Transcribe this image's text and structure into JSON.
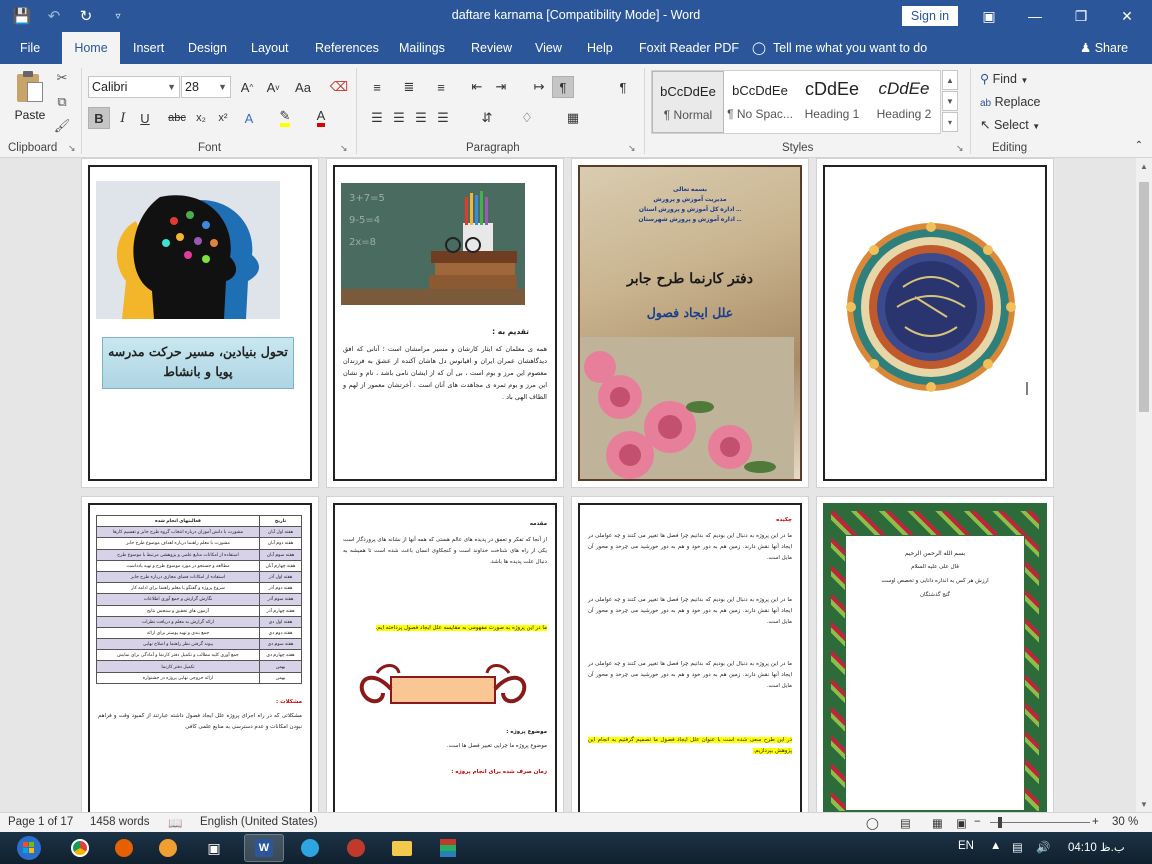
{
  "window": {
    "title": "daftare karnama [Compatibility Mode]  -  Word",
    "sign_in": "Sign in"
  },
  "tabs": {
    "items": [
      "File",
      "Home",
      "Insert",
      "Design",
      "Layout",
      "References",
      "Mailings",
      "Review",
      "View",
      "Help",
      "Foxit Reader PDF"
    ],
    "active": "Home",
    "tell_me": "Tell me what you want to do",
    "share": "Share"
  },
  "ribbon": {
    "clipboard": {
      "label": "Clipboard",
      "paste": "Paste"
    },
    "font": {
      "label": "Font",
      "family": "Calibri",
      "size": "28",
      "bold": "B",
      "italic": "I",
      "underline": "U",
      "strike": "abc"
    },
    "paragraph": {
      "label": "Paragraph"
    },
    "styles": {
      "label": "Styles",
      "items": [
        {
          "sample": "bCcDdEe",
          "name": "¶ Normal"
        },
        {
          "sample": "bCcDdEe",
          "name": "¶ No Spac..."
        },
        {
          "sample": "cDdEe",
          "name": "Heading 1"
        },
        {
          "sample": "cDdEe",
          "name": "Heading 2"
        }
      ]
    },
    "editing": {
      "label": "Editing",
      "find": "Find",
      "replace": "Replace",
      "select": "Select"
    }
  },
  "pages": {
    "p1": {
      "caption": "تحول بنیادین، مسیر حرکت مدرسه پویا و بانشاط"
    },
    "p2": {
      "dedication_title": "تقدیم به :",
      "dedication_text": "همه ی معلمان که ایثار کارشان و مسیر مرامشان است ؛ آنانی که افق دیدگاهشان عمران ایران و اقیانوس دل هاشان آکنده از عشق به فرزندان معصوم این مرز و بوم است ، بی آن که از ایشان نامی باشد ، نام و نشان این مرز و بوم ثمره ی مجاهدت های آنان است . آخرتشان معمور از لهم و الطاف الهی باد ."
    },
    "p3": {
      "top_lines": [
        "بسمه تعالی",
        "مدیریت آموزش و پرورش",
        "اداره کل آموزش و پرورش استان ...",
        "اداره آموزش و پرورش شهرستان ..."
      ],
      "title": "دفتر کارنما طرح جابر",
      "subtitle": "علل ایجاد فصول"
    },
    "p5": {
      "header": [
        "تاریخ",
        "فعالیتهای انجام شده"
      ],
      "rows": [
        [
          "هفته اول آبان",
          "مشورت با دانش آموزان درباره انتخاب گروه طرح جابر و تقسیم کارها"
        ],
        [
          "هفته دوم آبان",
          "مشورت با معلم راهنما درباره اهداف موضوع طرح جابر"
        ],
        [
          "هفته سوم آبان",
          "استفاده از امکانات منابع علمی و پژوهشی مرتبط با موضوع طرح"
        ],
        [
          "هفته چهارم آبان",
          "مطالعه و جستجو در مورد موضوع طرح و تهیه یادداشت"
        ],
        [
          "هفته اول آذر",
          "استفاده از امکانات فضای مجازی درباره طرح جابر"
        ],
        [
          "هفته دوم آذر",
          "شروع پروژه و گفتگو با معلم راهنما برای ادامه کار"
        ],
        [
          "هفته سوم آذر",
          "نگارش گزارش و جمع آوری اطلاعات"
        ],
        [
          "هفته چهارم آذر",
          "آزمون های تحقیق و سنجش نتایج"
        ],
        [
          "هفته اول دی",
          "ارائه گزارش به معلم و دریافت نظرات"
        ],
        [
          "هفته دوم دی",
          "جمع بندی و تهیه پوستر برای ارائه"
        ],
        [
          "هفته سوم دی",
          "پیوند گرفتن نظر راهنما و اصلاح نهایی"
        ],
        [
          "هفته چهارم دی",
          "جمع آوری کلیه مطالب و تکمیل دفتر کارنما و آمادگی برای نمایش"
        ],
        [
          "بهمن",
          "تکمیل دفتر کارنما"
        ],
        [
          "بهمن",
          "ارائه خروجی نهایی پروژه در جشنواره"
        ]
      ],
      "problems_title": "مشکلات :",
      "problems_text": "مشکلاتی که در راه اجرای پروژه علل ایجاد فصول داشته عبارتند از کمبود وقت و فراهم نبودن امکانات و عدم دسترسی به منابع علمی کافی"
    },
    "p6": {
      "intro_title": "مقدمه",
      "intro_text": "از آنجا که تفکر و تعمق در پدیده های عالم هستی که همه آنها از نشانه های پروردگار است یکی از راه های شناخت خداوند است و کنجکاوی انسان باعث شده است تا همیشه به دنبال علت پدیده ها باشد.",
      "highlight": "ما در این پروژه به صورت مفهومی به مقایسه علل ایجاد فصول پرداخته ایم.",
      "subject_title": "موضوع پروژه :",
      "subject_text": "موضوع پروژه ما چرایی تغییر فصل ها است.",
      "time_title": "زمان صرف شده برای انجام پروژه :"
    },
    "p7": {
      "title": "چکیده",
      "text": "ما در این پروژه به دنبال این بودیم که بدانیم چرا فصل ها تغییر می کنند و چه عواملی در ایجاد آنها نقش دارند. زمین هم به دور خود و هم به دور خورشید می چرخد و محور آن مایل است.",
      "highlight": "در این طرح سعی شده است با عنوان علل ایجاد فصول ما تصمیم گرفتیم به انجام این پژوهش بپردازیم."
    },
    "p8": {
      "title": "بسم الله الرحمن الرحیم",
      "lines": [
        "قال علی علیه السلام",
        "ارزش هر کس به اندازه دانایی و تخصص اوست",
        "گنج گذشتگان"
      ]
    }
  },
  "status": {
    "page": "Page 1 of 17",
    "words": "1458 words",
    "language": "English (United States)",
    "zoom": "30 %"
  },
  "taskbar": {
    "lang": "EN",
    "clock": "04:10 ب.ظ"
  }
}
